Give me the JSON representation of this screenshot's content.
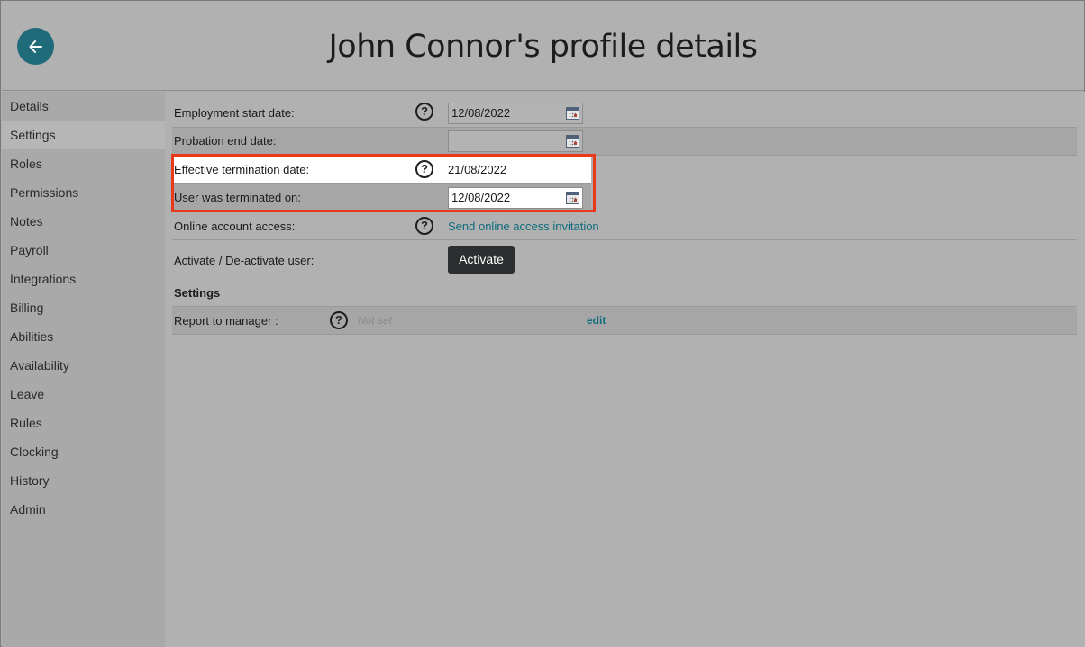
{
  "header": {
    "title": "John Connor's profile details",
    "back_icon": "arrow-left-icon",
    "accent_color": "#1f6b7a"
  },
  "sidebar": {
    "active": "Settings",
    "items": [
      {
        "label": "Details"
      },
      {
        "label": "Settings"
      },
      {
        "label": "Roles"
      },
      {
        "label": "Permissions"
      },
      {
        "label": "Notes"
      },
      {
        "label": "Payroll"
      },
      {
        "label": "Integrations"
      },
      {
        "label": "Billing"
      },
      {
        "label": "Abilities"
      },
      {
        "label": "Availability"
      },
      {
        "label": "Leave"
      },
      {
        "label": "Rules"
      },
      {
        "label": "Clocking"
      },
      {
        "label": "History"
      },
      {
        "label": "Admin"
      }
    ]
  },
  "form": {
    "employment_start": {
      "label": "Employment start date:",
      "value": "12/08/2022"
    },
    "probation_end": {
      "label": "Probation end date:",
      "value": ""
    },
    "effective_termination": {
      "label": "Effective termination date:",
      "value": "21/08/2022"
    },
    "terminated_on": {
      "label": "User was terminated on:",
      "value": "12/08/2022"
    },
    "online_access": {
      "label": "Online account access:",
      "link": "Send online access invitation"
    },
    "activate": {
      "label": "Activate / De-activate user:",
      "button": "Activate"
    },
    "settings_heading": "Settings",
    "report_to_manager": {
      "label": "Report to manager :",
      "value": "Not set",
      "edit": "edit"
    }
  },
  "colors": {
    "highlight": "#e8391d",
    "link": "#0f6d7e",
    "button_dark": "#2b2f30"
  }
}
